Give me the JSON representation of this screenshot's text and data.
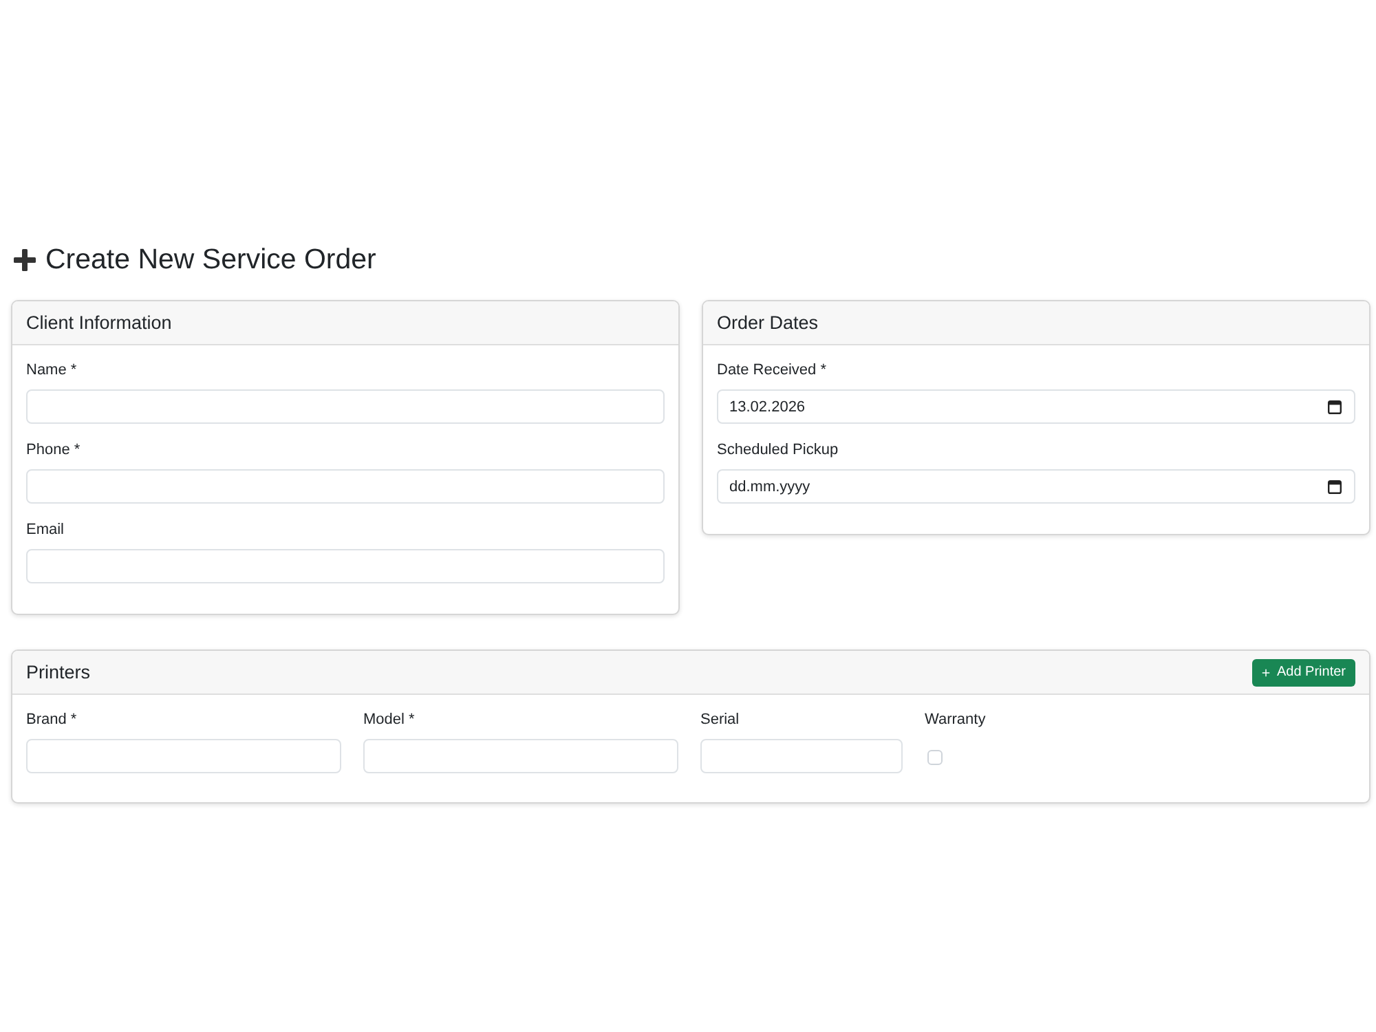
{
  "page": {
    "title": "Create New Service Order"
  },
  "client_information": {
    "title": "Client Information",
    "fields": [
      {
        "label": "Name *"
      },
      {
        "label": "Phone *"
      },
      {
        "label": "Email"
      }
    ]
  },
  "order_dates": {
    "title": "Order Dates",
    "fields": [
      {
        "label": "Date Received *",
        "value": "13.02.2026"
      },
      {
        "label": "Scheduled Pickup",
        "placeholder": "dd.mm.yyyy"
      }
    ]
  },
  "printers": {
    "title": "Printers",
    "add_button": "Add Printer",
    "fields": [
      {
        "kind": "text",
        "label": "Brand *"
      },
      {
        "kind": "text",
        "label": "Model *"
      },
      {
        "kind": "text",
        "label": "Serial"
      },
      {
        "kind": "checkbox",
        "label": "Warranty",
        "checked": false
      }
    ]
  }
}
